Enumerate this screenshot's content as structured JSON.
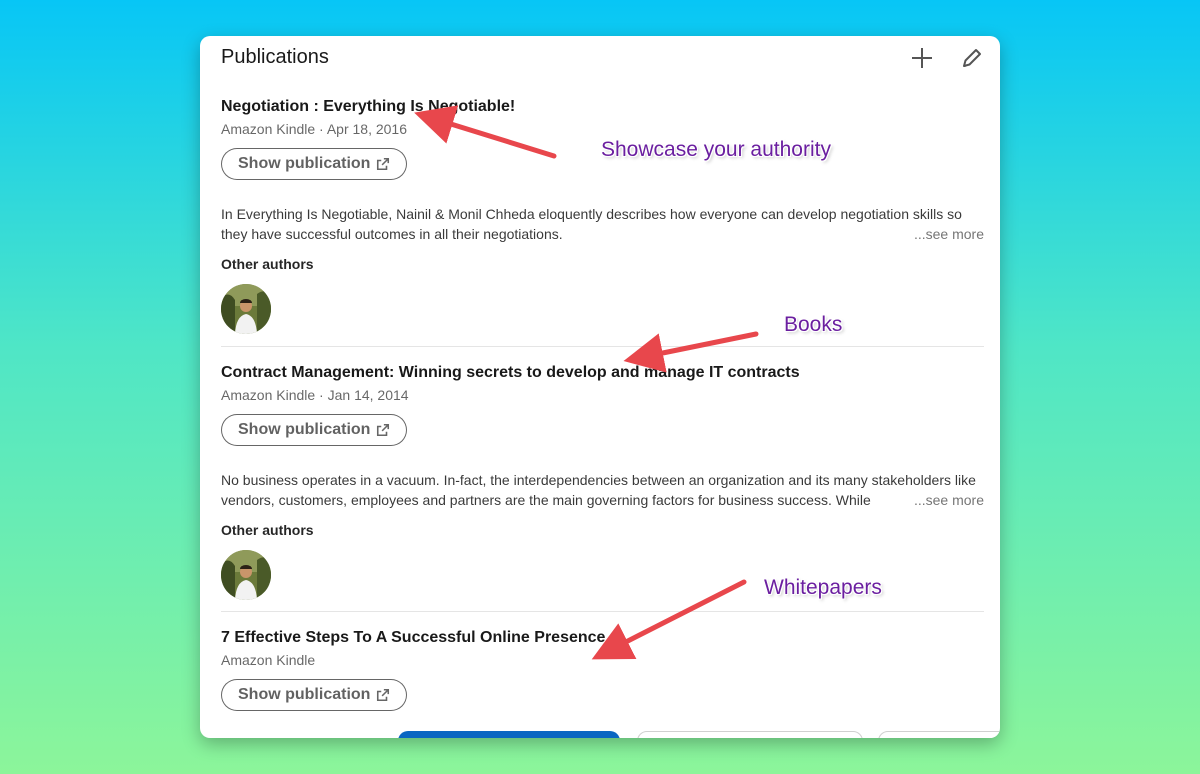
{
  "card": {
    "title": "Publications",
    "add_icon": "plus-icon",
    "edit_icon": "pencil-icon"
  },
  "publications": [
    {
      "title": "Negotiation : Everything Is Negotiable!",
      "meta": "Amazon Kindle · Apr 18, 2016",
      "button": "Show publication",
      "description": "In Everything Is Negotiable, Nainil & Monil Chheda eloquently describes how everyone can develop negotiation skills so they have successful outcomes in all their negotiations.",
      "see_more": "...see more",
      "other_authors_label": "Other authors"
    },
    {
      "title": "Contract Management: Winning secrets to develop and manage IT contracts",
      "meta": "Amazon Kindle · Jan 14, 2014",
      "button": "Show publication",
      "description": "No business operates in a vacuum. In-fact, the interdependencies between an organization and its many stakeholders like vendors, customers, employees and partners are the main governing factors for business success. While",
      "see_more": "...see more",
      "other_authors_label": "Other authors"
    },
    {
      "title": "7 Effective Steps To A Successful Online Presence",
      "meta": "Amazon Kindle",
      "button": "Show publication"
    }
  ],
  "annotations": {
    "first": "Showcase your authority",
    "second": "Books",
    "third": "Whitepapers"
  },
  "colors": {
    "annotation_text": "#6b1fa0",
    "arrow": "#e8474c",
    "primary_blue": "#0a66c2"
  }
}
